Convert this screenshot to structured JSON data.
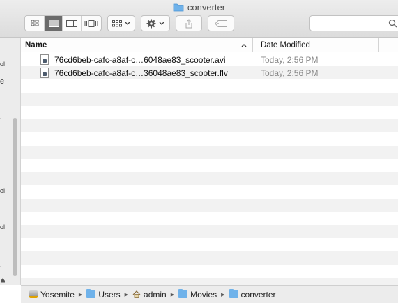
{
  "window": {
    "title": "converter"
  },
  "toolbar": {
    "view_buttons": [
      "icon-view-icon",
      "list-view-icon",
      "column-view-icon",
      "cover-flow-icon"
    ],
    "active_view": "list-view-icon",
    "arrange_icon": "arrange-icon",
    "action_icon": "gear-icon",
    "share_icon": "share-icon",
    "tag_icon": "tag-icon",
    "search_icon": "search-icon"
  },
  "sidebar": {
    "fragments": [
      "ol",
      "e",
      ".",
      "ol",
      "ol",
      "."
    ]
  },
  "columns": {
    "name": "Name",
    "date_modified": "Date Modified"
  },
  "files": [
    {
      "name": "76cd6beb-cafc-a8af-c…6048ae83_scooter.avi",
      "date": "Today, 2:56 PM"
    },
    {
      "name": "76cd6beb-cafc-a8af-c…36048ae83_scooter.flv",
      "date": "Today, 2:56 PM"
    }
  ],
  "pathbar": {
    "items": [
      "Yosemite",
      "Users",
      "admin",
      "Movies",
      "converter"
    ]
  },
  "colors": {
    "folder_blue": "#6fb2ea",
    "active_button": "#6b6b6b"
  }
}
